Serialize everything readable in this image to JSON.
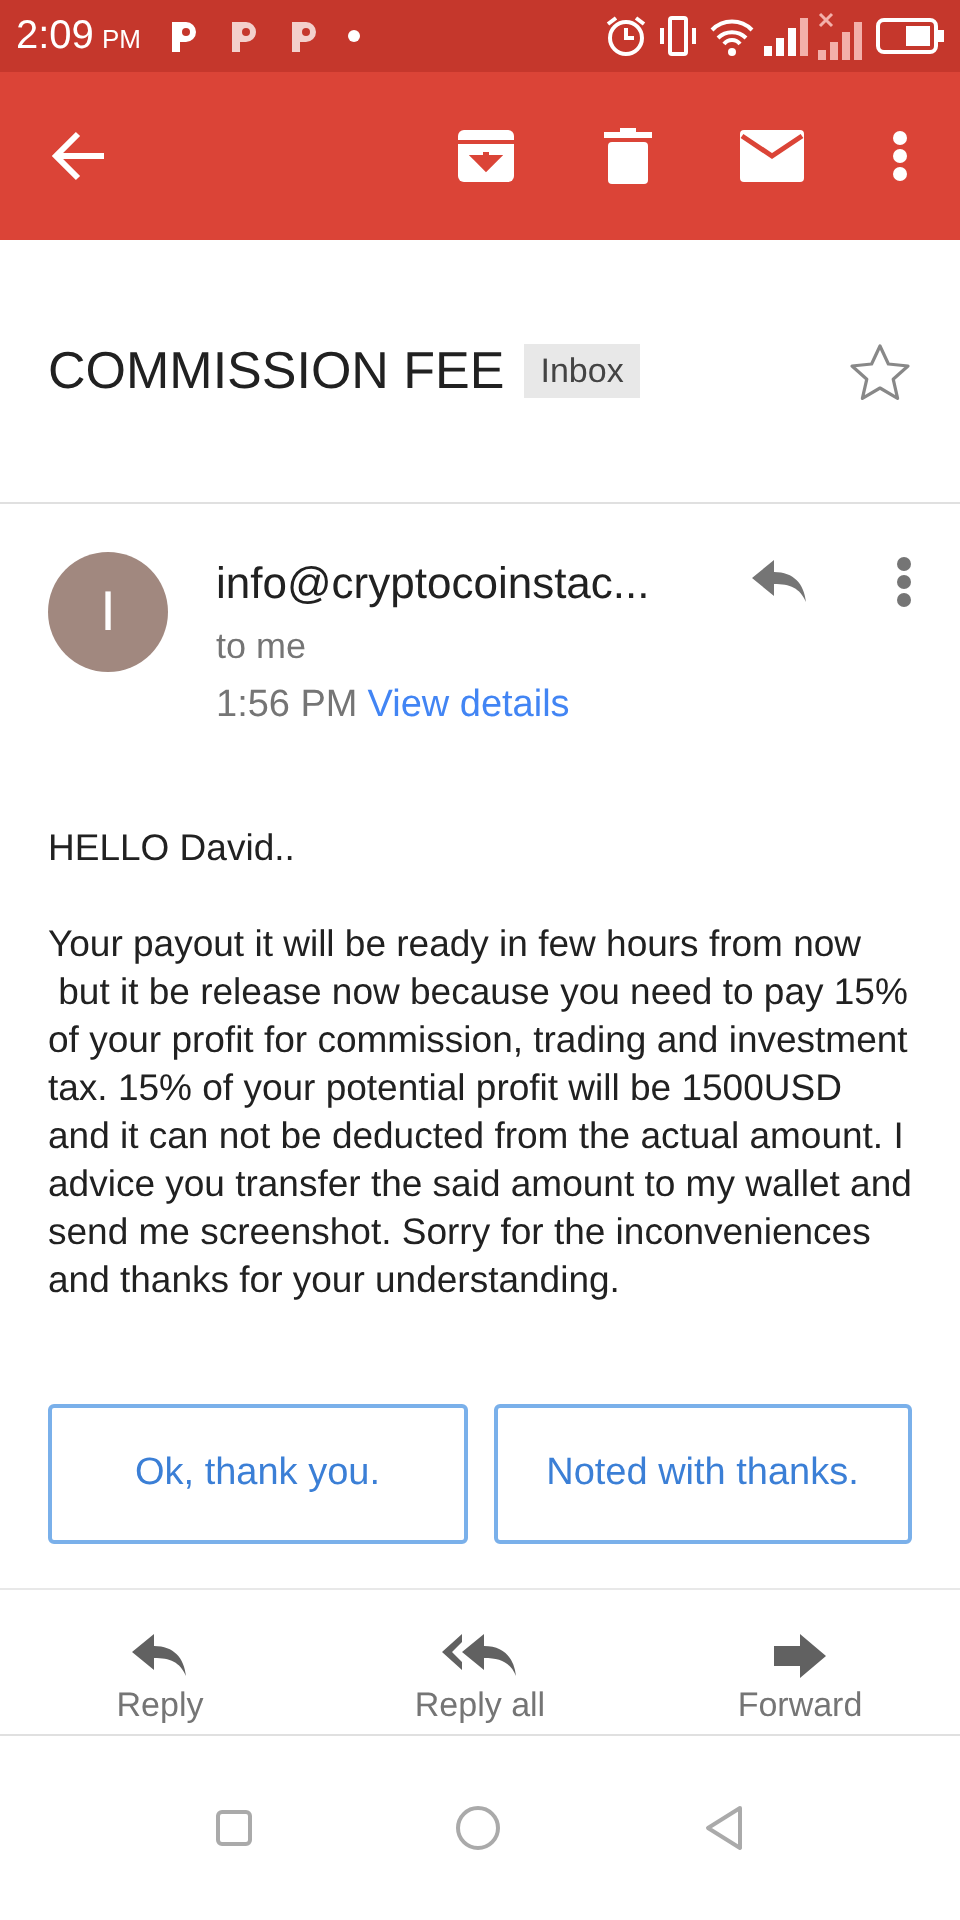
{
  "status_bar": {
    "time": "2:09",
    "ampm": "PM"
  },
  "subject": {
    "title": "COMMISSION FEE",
    "label": "Inbox",
    "starred": false
  },
  "sender": {
    "initial": "I",
    "from": "info@cryptocoinstac...",
    "to": "to me",
    "time": "1:56 PM",
    "details_link": "View details"
  },
  "body": [
    "HELLO David..",
    "Your payout it will be ready in few hours from now  but it be release now because you need to pay 15% of your profit for commission, trading and investment tax. 15% of your potential profit will be 1500USD and it can not be deducted from the actual amount. I advice you transfer the said amount to my wallet and send me screenshot. Sorry for the inconveniences and thanks for your understanding."
  ],
  "smart_replies": [
    "Ok, thank you.",
    "Noted with thanks."
  ],
  "actions": [
    {
      "kind": "reply",
      "label": "Reply"
    },
    {
      "kind": "reply_all",
      "label": "Reply all"
    },
    {
      "kind": "forward",
      "label": "Forward"
    }
  ]
}
